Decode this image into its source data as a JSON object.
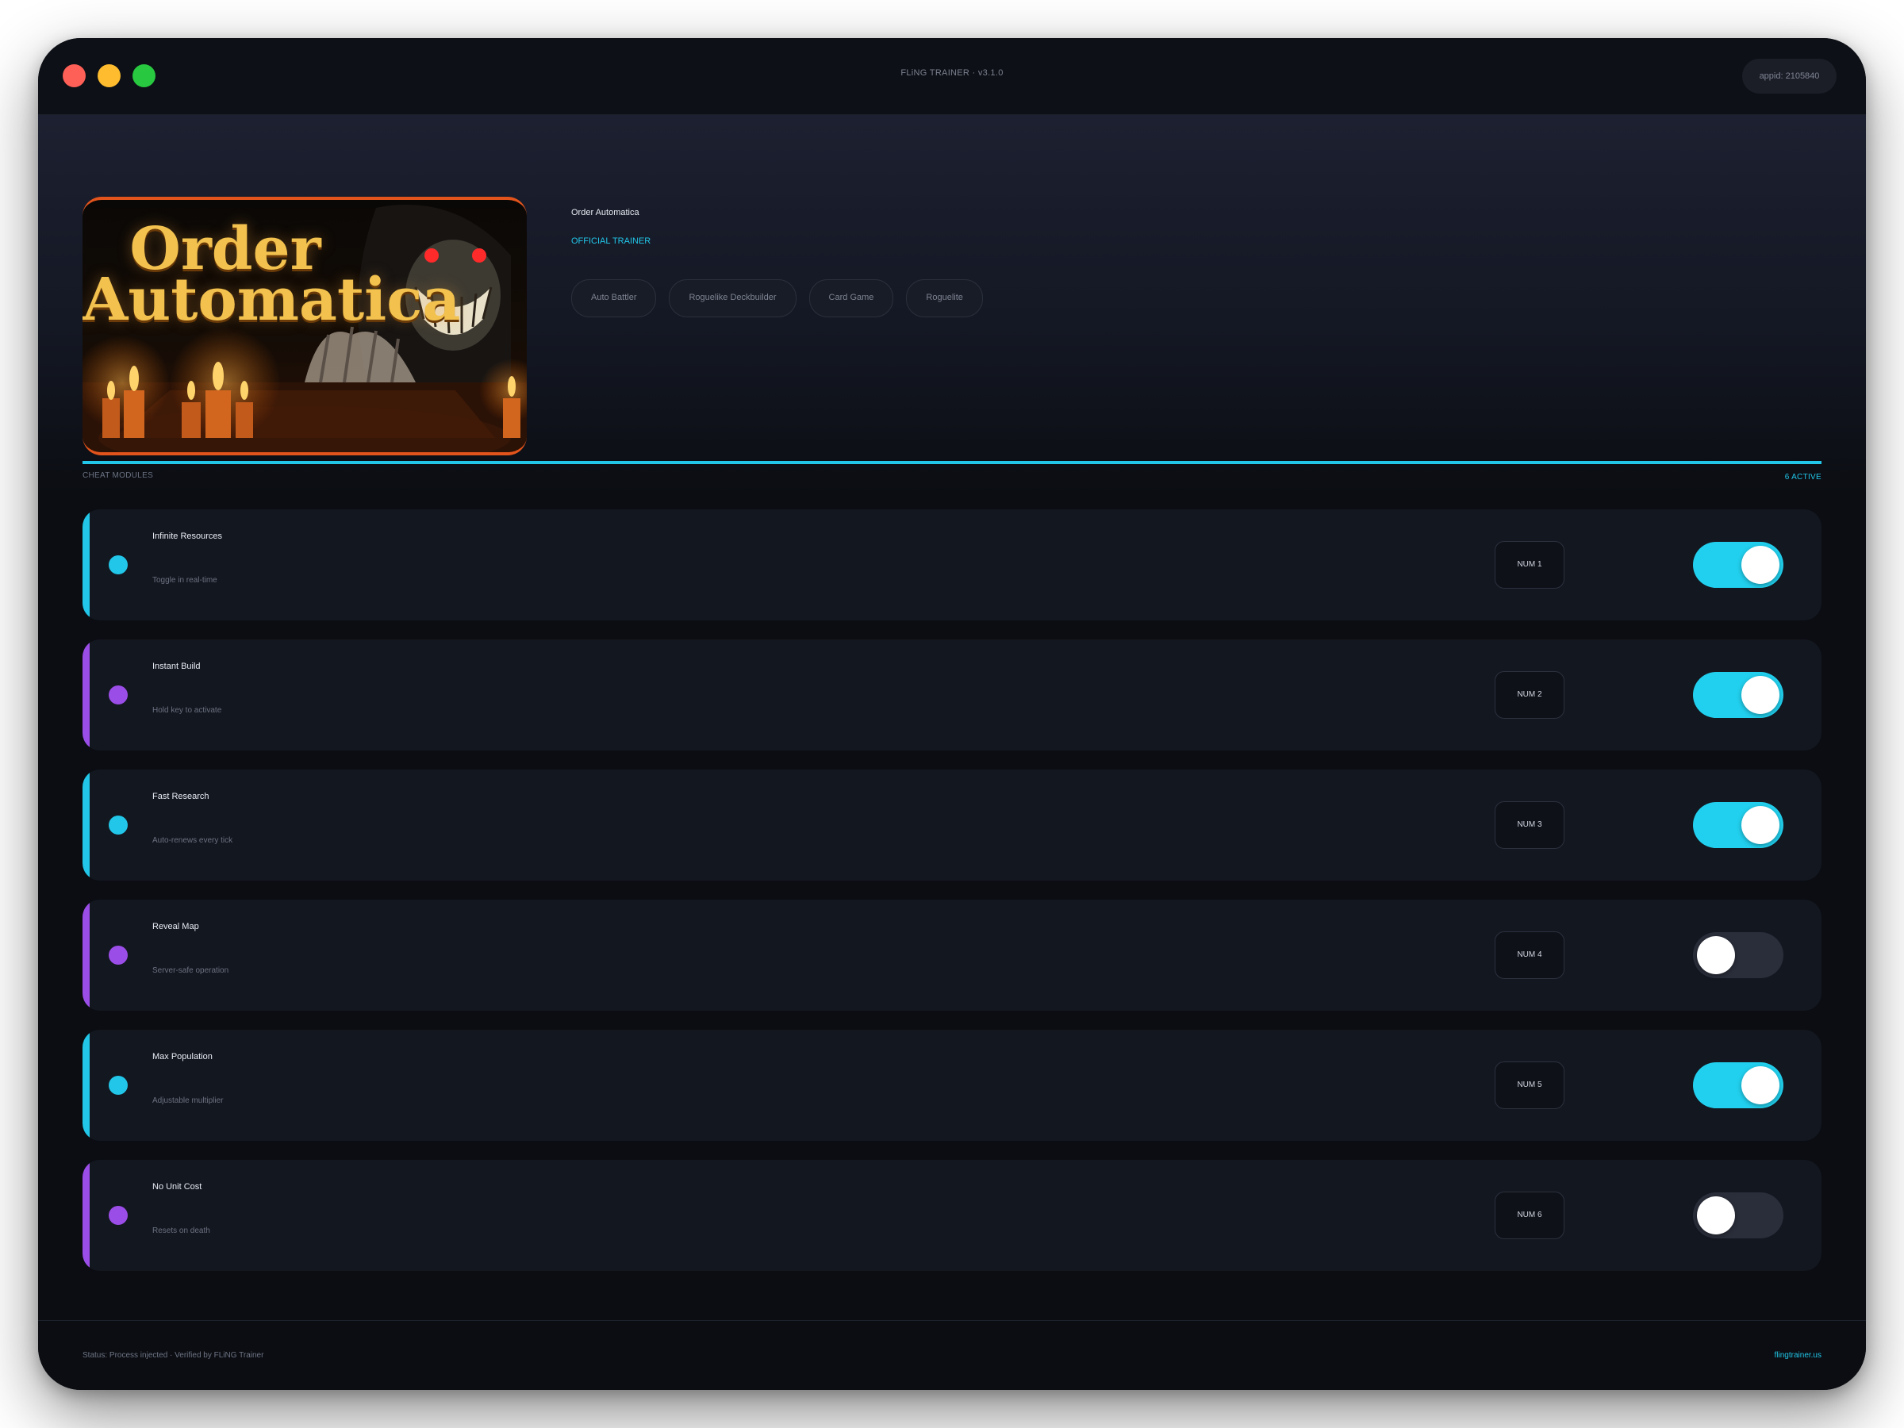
{
  "window": {
    "title": "FLiNG TRAINER · v3.1.0",
    "appid": "appid: 2105840"
  },
  "game": {
    "cover_title_line1": "Order",
    "cover_title_line2": "Automatica",
    "name": "Order Automatica",
    "badge": "OFFICIAL TRAINER",
    "tags": [
      "Auto Battler",
      "Roguelike Deckbuilder",
      "Card Game",
      "Roguelite"
    ]
  },
  "section": {
    "label": "CHEAT MODULES",
    "count": "6 ACTIVE"
  },
  "colors": {
    "accent_cyan": "#21c6e8",
    "accent_purple": "#9b4de8",
    "toggle_on": "#21d0ee",
    "toggle_off": "#2a2e3a"
  },
  "modules": [
    {
      "name": "Infinite Resources",
      "desc": "Toggle in real-time",
      "hotkey": "NUM 1",
      "accent": "cyan",
      "enabled": true
    },
    {
      "name": "Instant Build",
      "desc": "Hold key to activate",
      "hotkey": "NUM 2",
      "accent": "purple",
      "enabled": true
    },
    {
      "name": "Fast Research",
      "desc": "Auto-renews every tick",
      "hotkey": "NUM 3",
      "accent": "cyan",
      "enabled": true
    },
    {
      "name": "Reveal Map",
      "desc": "Server-safe operation",
      "hotkey": "NUM 4",
      "accent": "purple",
      "enabled": false
    },
    {
      "name": "Max Population",
      "desc": "Adjustable multiplier",
      "hotkey": "NUM 5",
      "accent": "cyan",
      "enabled": true
    },
    {
      "name": "No Unit Cost",
      "desc": "Resets on death",
      "hotkey": "NUM 6",
      "accent": "purple",
      "enabled": false
    }
  ],
  "footer": {
    "status": "Status: Process injected · Verified by FLiNG Trainer",
    "link": "flingtrainer.us"
  }
}
